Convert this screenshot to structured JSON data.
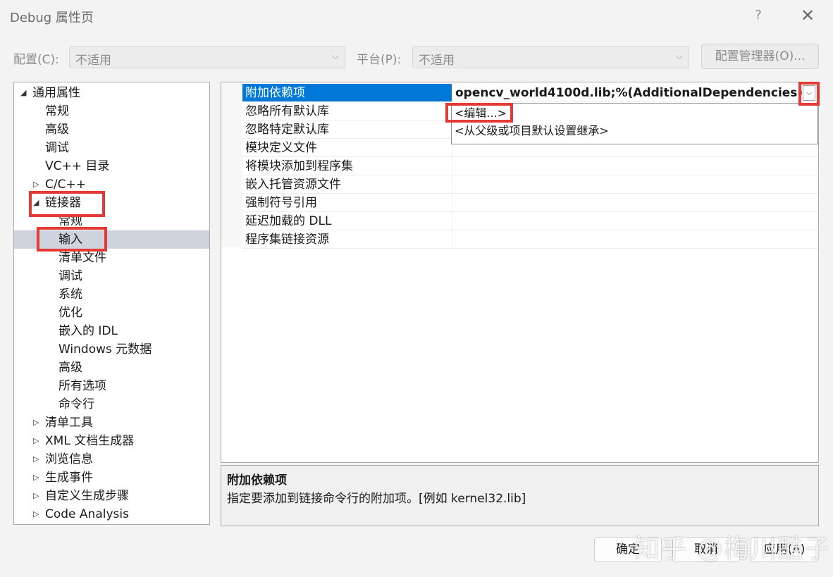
{
  "window": {
    "title": "Debug 属性页",
    "help_label": "?",
    "close_label": "✕"
  },
  "config_bar": {
    "config_label": "配置(C):",
    "config_value": "不适用",
    "platform_label": "平台(P):",
    "platform_value": "不适用",
    "manager_button": "配置管理器(O)..."
  },
  "tree": [
    {
      "label": "通用属性",
      "expander": "expanded",
      "level": 0
    },
    {
      "label": "常规",
      "expander": "none",
      "level": 1
    },
    {
      "label": "高级",
      "expander": "none",
      "level": 1
    },
    {
      "label": "调试",
      "expander": "none",
      "level": 1
    },
    {
      "label": "VC++ 目录",
      "expander": "none",
      "level": 1
    },
    {
      "label": "C/C++",
      "expander": "collapsed",
      "level": 1
    },
    {
      "label": "链接器",
      "expander": "expanded",
      "level": 1
    },
    {
      "label": "常规",
      "expander": "none",
      "level": 2
    },
    {
      "label": "输入",
      "expander": "none",
      "level": 2,
      "selected": true
    },
    {
      "label": "清单文件",
      "expander": "none",
      "level": 2
    },
    {
      "label": "调试",
      "expander": "none",
      "level": 2
    },
    {
      "label": "系统",
      "expander": "none",
      "level": 2
    },
    {
      "label": "优化",
      "expander": "none",
      "level": 2
    },
    {
      "label": "嵌入的 IDL",
      "expander": "none",
      "level": 2
    },
    {
      "label": "Windows 元数据",
      "expander": "none",
      "level": 2
    },
    {
      "label": "高级",
      "expander": "none",
      "level": 2
    },
    {
      "label": "所有选项",
      "expander": "none",
      "level": 2
    },
    {
      "label": "命令行",
      "expander": "none",
      "level": 2
    },
    {
      "label": "清单工具",
      "expander": "collapsed",
      "level": 1
    },
    {
      "label": "XML 文档生成器",
      "expander": "collapsed",
      "level": 1
    },
    {
      "label": "浏览信息",
      "expander": "collapsed",
      "level": 1
    },
    {
      "label": "生成事件",
      "expander": "collapsed",
      "level": 1
    },
    {
      "label": "自定义生成步骤",
      "expander": "collapsed",
      "level": 1
    },
    {
      "label": "Code Analysis",
      "expander": "collapsed",
      "level": 1
    }
  ],
  "properties": [
    {
      "name": "附加依赖项",
      "value": "opencv_world4100d.lib;%(AdditionalDependencies)",
      "selected": true
    },
    {
      "name": "忽略所有默认库",
      "value": ""
    },
    {
      "name": "忽略特定默认库",
      "value": ""
    },
    {
      "name": "模块定义文件",
      "value": ""
    },
    {
      "name": "将模块添加到程序集",
      "value": ""
    },
    {
      "name": "嵌入托管资源文件",
      "value": ""
    },
    {
      "name": "强制符号引用",
      "value": ""
    },
    {
      "name": "延迟加载的 DLL",
      "value": ""
    },
    {
      "name": "程序集链接资源",
      "value": ""
    }
  ],
  "value_dropdown": {
    "items": [
      "<编辑...>",
      "<从父级或项目默认设置继承>"
    ]
  },
  "description": {
    "title": "附加依赖项",
    "text": "指定要添加到链接命令行的附加项。[例如 kernel32.lib]"
  },
  "buttons": {
    "ok": "确定",
    "cancel": "取消",
    "apply": "应用(A)"
  },
  "watermark": "知乎 @梅川酷子",
  "colors": {
    "selection": "#0078d7",
    "tree_selection": "#cfd3dd",
    "annotation_red": "#e53935"
  }
}
